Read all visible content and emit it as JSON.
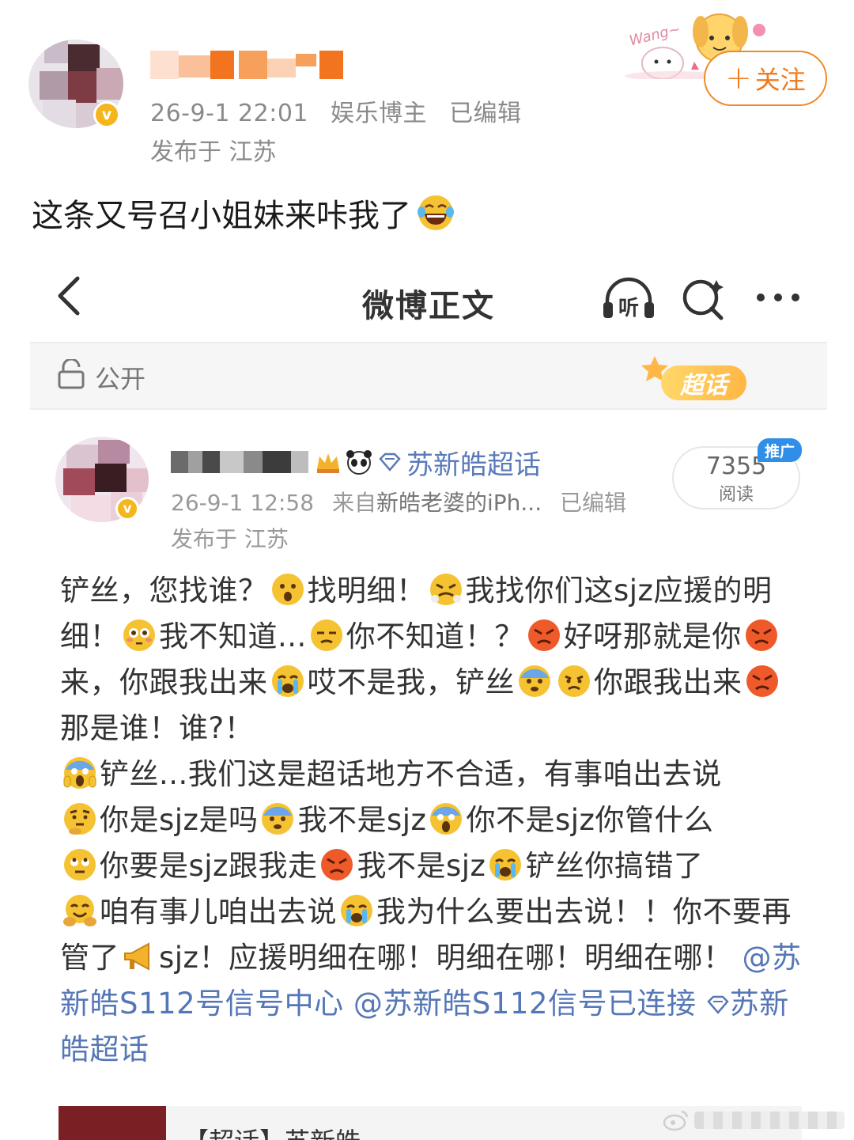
{
  "outer_post": {
    "meta_date": "26-9-1 22:01",
    "meta_role": "娱乐博主",
    "meta_edited": "已编辑",
    "location": "发布于 江苏",
    "follow_label": "关注",
    "follow_plus": "+",
    "deco_text": "Wang~",
    "verified_badge": "v",
    "text": "这条又号召小姐妹来咔我了"
  },
  "inner_screenshot": {
    "nav": {
      "title": "微博正文",
      "listen_label": "听"
    },
    "scope_label": "公开",
    "chaohua_tag": "超话",
    "author": {
      "topic_tag": "苏新皓超话",
      "verified_badge": "v",
      "meta_date": "26-9-1 12:58",
      "meta_source_prefix": "来自",
      "meta_source": "新皓老婆的iPh...",
      "meta_edited": "已编辑",
      "location": "发布于 江苏"
    },
    "read_count": {
      "number": "7355",
      "label": "阅读",
      "promo_badge": "推广"
    },
    "body": {
      "s1": "铲丝，您找谁？",
      "s2": "找明细！",
      "s3": "我找你们这sjz应援的明细！",
      "s4": "我不知道...",
      "s5": "你不知道！？",
      "s6": "好呀那就是你",
      "s7": "来，你跟我出来",
      "s8": "哎不是我，铲丝",
      "s9": "你跟我出来",
      "s10": "那是谁！谁?！",
      "s11": "铲丝...我们这是超话地方不合适，有事咱出去说",
      "s12": "你是sjz是吗",
      "s13": "我不是sjz",
      "s14": "你不是sjz你管什么",
      "s15": "你要是sjz跟我走",
      "s16": "我不是sjz",
      "s17": "铲丝你搞错了",
      "s18": "咱有事儿咱出去说",
      "s19": "我为什么要出去说！！你不要再管了",
      "s20": "sjz！应援明细在哪！明细在哪！明细在哪！",
      "mention1": "@苏新皓S112号信号中心",
      "mention2": "@苏新皓S112信号已连接",
      "topic_link": "苏新皓超话"
    },
    "bottom_card_title": "【超话】苏新皓"
  },
  "emoji_names": [
    "surprised",
    "steam-angry",
    "flushed",
    "unamused",
    "angry",
    "angry",
    "crying",
    "fearful",
    "frown",
    "angry",
    "scream",
    "thinking",
    "fearful",
    "scream",
    "eye-roll",
    "angry",
    "crying",
    "hug",
    "crying",
    "megaphone"
  ],
  "colors": {
    "follow_orange": "#f07c1e",
    "link_blue": "#5577b7",
    "emoji_yellow": "#f5c232",
    "emoji_red": "#ef5a2a",
    "verified_gold": "#f5b61c"
  }
}
